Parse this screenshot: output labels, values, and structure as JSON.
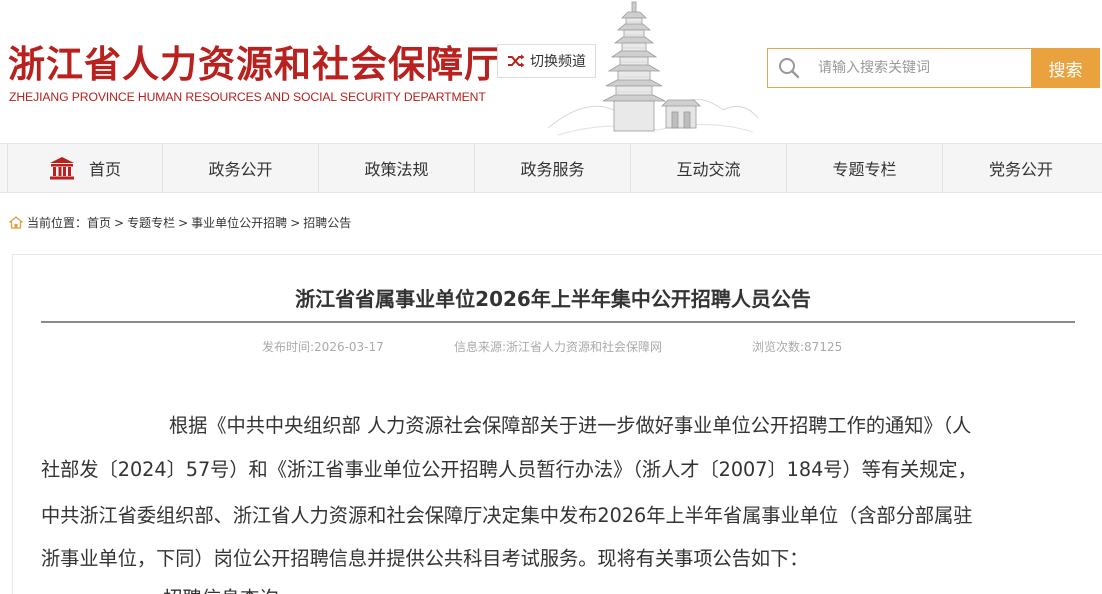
{
  "header": {
    "logo_cn": "浙江省人力资源和社会保障厅",
    "logo_en": "ZHEJIANG PROVINCE HUMAN RESOURCES AND SOCIAL SECURITY DEPARTMENT",
    "switch_label": "切换频道",
    "search_placeholder": "请输入搜索关键词",
    "search_button": "搜索"
  },
  "nav": {
    "items": [
      {
        "label": "首页"
      },
      {
        "label": "政务公开"
      },
      {
        "label": "政策法规"
      },
      {
        "label": "政务服务"
      },
      {
        "label": "互动交流"
      },
      {
        "label": "专题专栏"
      },
      {
        "label": "党务公开"
      }
    ]
  },
  "breadcrumb": {
    "prefix": "当前位置：",
    "items": [
      "首页",
      "专题专栏",
      "事业单位公开招聘",
      "招聘公告"
    ]
  },
  "article": {
    "title": "浙江省省属事业单位2026年上半年集中公开招聘人员公告",
    "publish_time": "发布时间:2026-03-17",
    "source": "信息来源:浙江省人力资源和社会保障网",
    "views": "浏览次数:87125",
    "lines": [
      "根据《中共中央组织部 人力资源社会保障部关于进一步做好事业单位公开招聘工作的通知》（人",
      "社部发〔2024〕57号）和《浙江省事业单位公开招聘人员暂行办法》（浙人才〔2007〕184号）等有关规定，",
      "中共浙江省委组织部、浙江省人力资源和社会保障厅决定集中发布2026年上半年省属事业单位（含部分部属驻",
      "浙事业单位，下同）岗位公开招聘信息并提供公共科目考试服务。现将有关事项公告如下："
    ],
    "next_heading": "一、招聘信息查询"
  },
  "colors": {
    "brand_red": "#b8211d",
    "accent_orange": "#eaa23f"
  }
}
